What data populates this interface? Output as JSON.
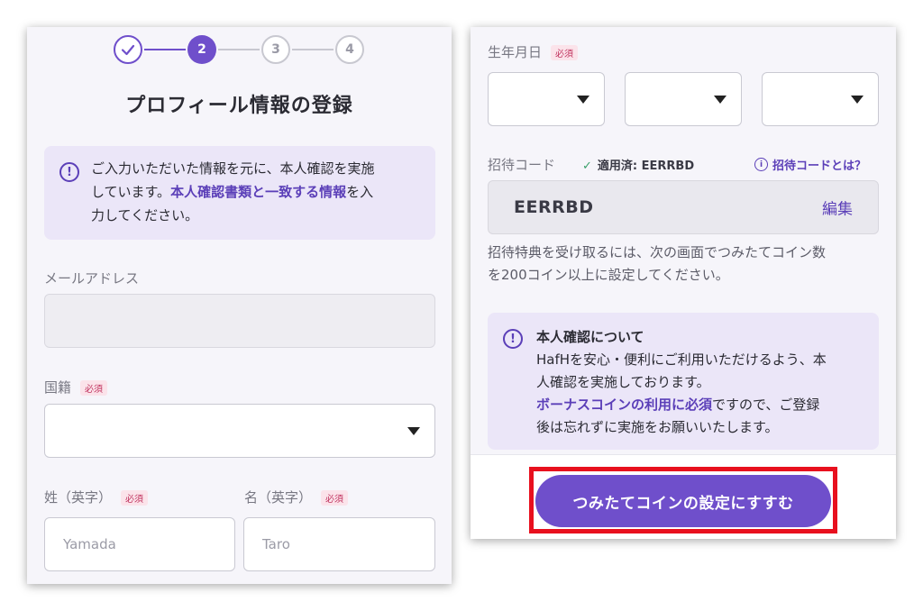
{
  "left": {
    "stepper": {
      "steps": [
        "",
        "2",
        "3",
        "4"
      ]
    },
    "title": "プロフィール情報の登録",
    "notice": {
      "icon": "exclamation-icon",
      "line1": "ご入力いただいた情報を元に、本人確認を実施",
      "line2_pre": "しています。",
      "line2_accent": "本人確認書類と一致する情報",
      "line2_post": "を入",
      "line3": "力してください。"
    },
    "email": {
      "label": "メールアドレス",
      "value": ""
    },
    "nationality": {
      "label": "国籍",
      "required": "必須",
      "value": ""
    },
    "last_name": {
      "label": "姓（英字）",
      "required": "必須",
      "placeholder": "Yamada"
    },
    "first_name": {
      "label": "名（英字）",
      "required": "必須",
      "placeholder": "Taro"
    }
  },
  "right": {
    "birthdate": {
      "label": "生年月日",
      "required": "必須"
    },
    "invite": {
      "label": "招待コード",
      "applied": "適用済: EERRBD",
      "help": "招待コードとは？",
      "code": "EERRBD",
      "edit": "編集"
    },
    "hint": {
      "line1": "招待特典を受け取るには、次の画面でつみたてコイン数",
      "line2": "を200コイン以上に設定してください。"
    },
    "kyc_notice": {
      "title": "本人確認について",
      "line1": "HafHを安心・便利にご利用いただけるよう、本",
      "line2": "人確認を実施しております。",
      "line3_accent": "ボーナスコインの利用に必須",
      "line3_post": "ですので、ご登録",
      "line4": "後は忘れずに実施をお願いいたします。"
    },
    "cta": "つみたてコインの設定にすすむ"
  },
  "colors": {
    "accent": "#6f4fcb",
    "highlight": "#e8101e",
    "required_bg": "#fbe3ea"
  }
}
